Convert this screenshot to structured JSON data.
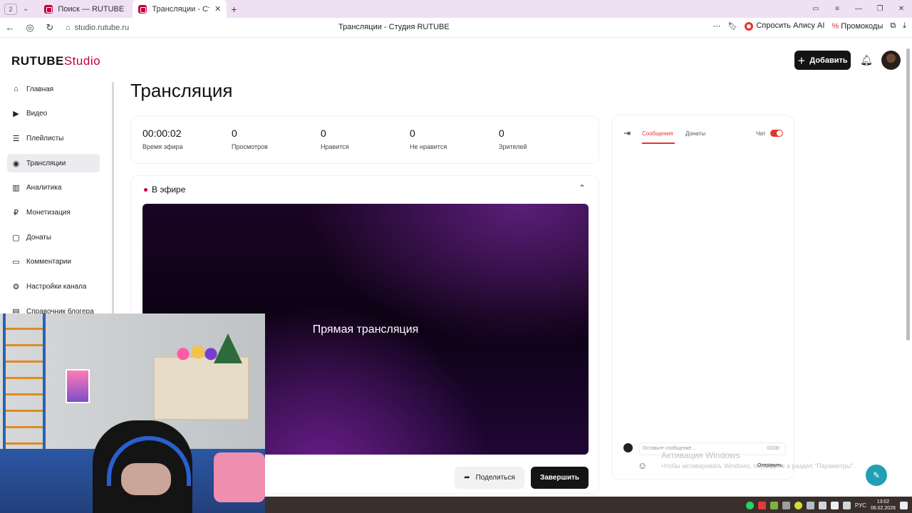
{
  "browser": {
    "tab_counter": "2",
    "tabs": [
      {
        "title": "Поиск — RUTUBE"
      },
      {
        "title": "Трансляции - Студия RUTUBE"
      }
    ],
    "url": "studio.rutube.ru",
    "page_title": "Трансляции - Студия RUTUBE",
    "alisa_label": "Спросить Алису AI",
    "promo_label": "Промокоды"
  },
  "header": {
    "logo_main": "RUTUBE",
    "logo_sub": "Studio",
    "add_label": "Добавить"
  },
  "sidebar": {
    "items": [
      {
        "label": "Главная",
        "icon": "home-icon"
      },
      {
        "label": "Видео",
        "icon": "video-icon"
      },
      {
        "label": "Плейлисты",
        "icon": "playlist-icon"
      },
      {
        "label": "Трансляции",
        "icon": "broadcast-icon",
        "active": true
      },
      {
        "label": "Аналитика",
        "icon": "analytics-icon"
      },
      {
        "label": "Монетизация",
        "icon": "ruble-icon"
      },
      {
        "label": "Донаты",
        "icon": "donate-icon"
      },
      {
        "label": "Комментарии",
        "icon": "comments-icon"
      },
      {
        "label": "Настройки канала",
        "icon": "settings-icon"
      },
      {
        "label": "Справочник блогера",
        "icon": "book-icon"
      }
    ]
  },
  "main": {
    "title": "Трансляция",
    "stats": [
      {
        "value": "00:00:02",
        "label": "Время эфира"
      },
      {
        "value": "0",
        "label": "Просмотров"
      },
      {
        "value": "0",
        "label": "Нравится"
      },
      {
        "value": "0",
        "label": "Не нравится"
      },
      {
        "value": "0",
        "label": "Зрителей"
      }
    ],
    "live_label": "В эфире",
    "preview_title": "Прямая трансляция",
    "share_label": "Поделиться",
    "end_label": "Завершить"
  },
  "chat": {
    "tab_messages": "Сообщения",
    "tab_donations": "Донаты",
    "toggle_label": "Чат",
    "toggle_on": true,
    "input_placeholder": "Оставьте сообщение...",
    "counter": "0/200",
    "send_label": "Отправить"
  },
  "watermark": {
    "line1": "Активация Windows",
    "line2": "Чтобы активировать Windows, перейдите в раздел \"Параметры\"."
  },
  "taskbar": {
    "lang": "РУС",
    "time": "13:02",
    "date": "06.02.2026"
  },
  "colors": {
    "accent": "#c4003a",
    "chat_accent": "#e5342e",
    "primary_button": "#141414"
  }
}
